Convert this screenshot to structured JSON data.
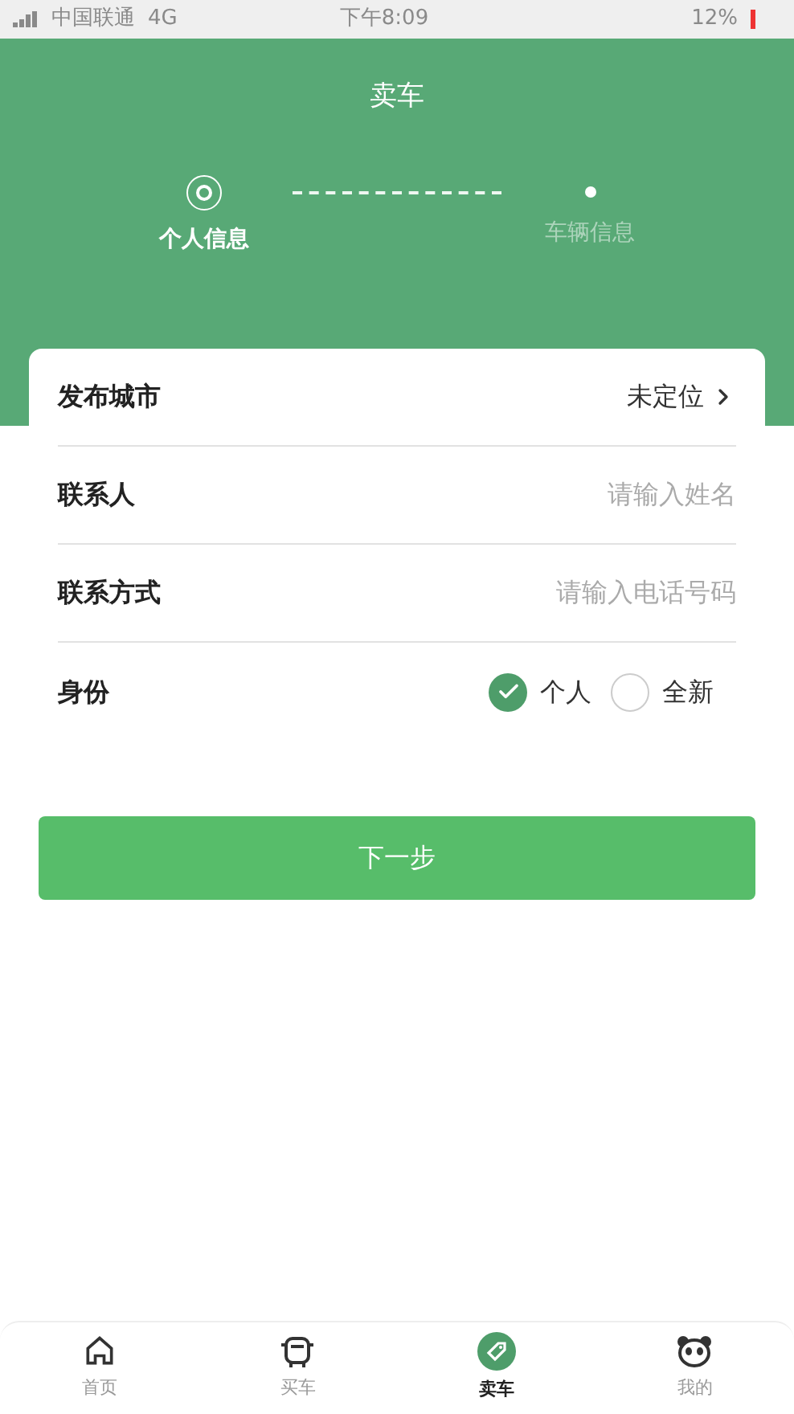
{
  "status_bar": {
    "carrier": "中国联通",
    "network": "4G",
    "time": "下午8:09",
    "battery": "12%"
  },
  "header": {
    "title": "卖车"
  },
  "steps": [
    {
      "label": "个人信息",
      "selected": true
    },
    {
      "label": "车辆信息",
      "selected": false
    }
  ],
  "form": {
    "rows": [
      {
        "kind": "select",
        "label": "发布城市",
        "value": "未定位"
      },
      {
        "kind": "input",
        "label": "联系人",
        "placeholder": "请输入姓名"
      },
      {
        "kind": "input",
        "label": "联系方式",
        "placeholder": "请输入电话号码"
      },
      {
        "kind": "radio",
        "label": "身份",
        "options": [
          {
            "label": "个人",
            "selected": true
          },
          {
            "label": "全新",
            "selected": false
          }
        ]
      }
    ]
  },
  "next_button": "下一步",
  "tab_bar": [
    {
      "label": "首页",
      "selected": false
    },
    {
      "label": "买车",
      "selected": false
    },
    {
      "label": "卖车",
      "selected": true
    },
    {
      "label": "我的",
      "selected": false
    }
  ]
}
